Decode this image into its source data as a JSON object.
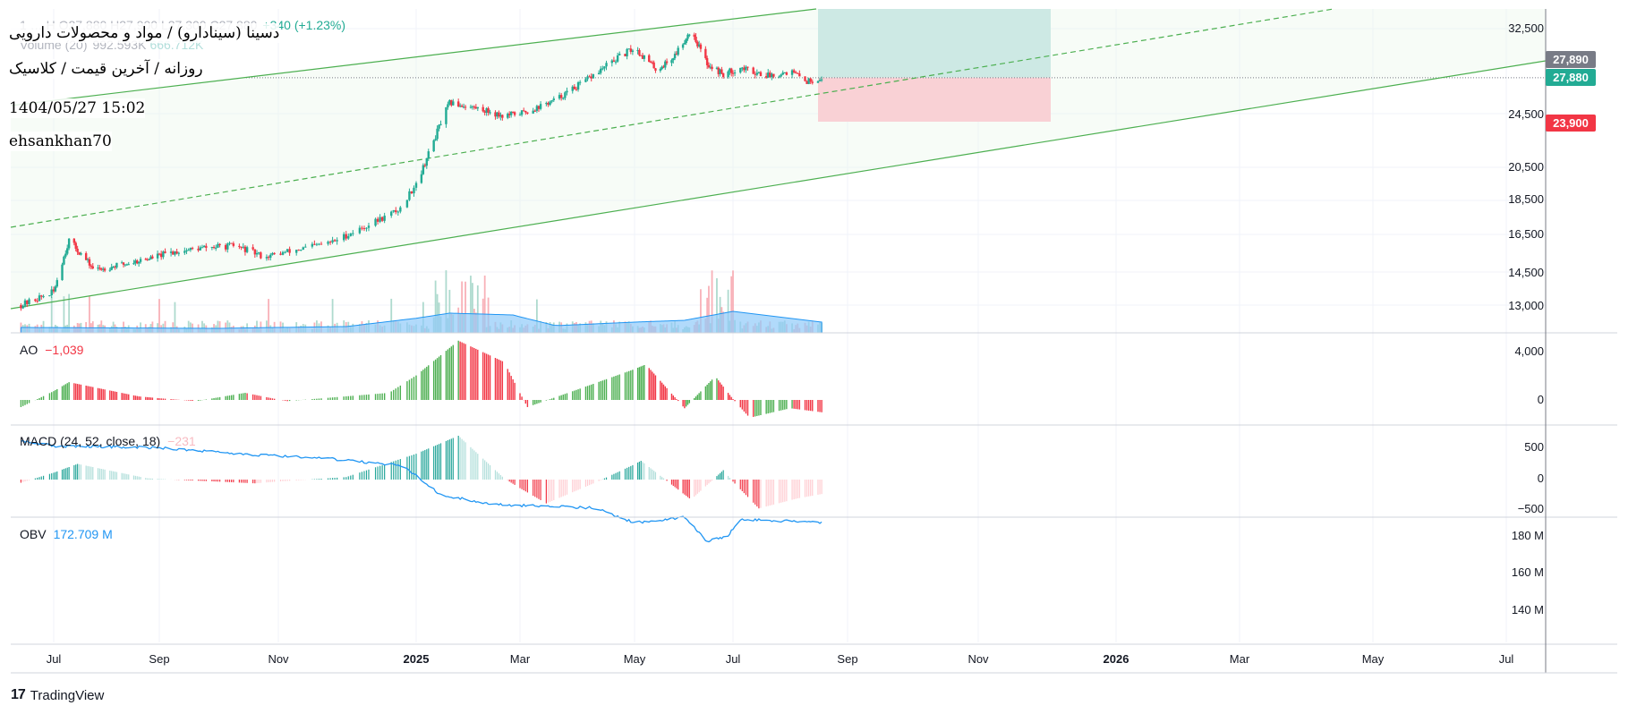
{
  "header": {
    "ohlc_text": "1 … H O27,880 H27,900 L27,300 C27,880",
    "change_text": "+340 (+1.23%)",
    "volume_text": "Volume (20)",
    "volume_value_1": "992.593K",
    "volume_value_2": "666.712K"
  },
  "info": {
    "title": "دسینا (سینادارو) / مواد و محصولات دارویی",
    "subtitle": "روزانه / آخرین قیمت / کلاسیک",
    "datetime": "1404/05/27 15:02",
    "author": "ehsankhan70"
  },
  "price_axis": {
    "ticks": [
      "32,500",
      "24,500",
      "20,500",
      "18,500",
      "16,500",
      "14,500",
      "13,000"
    ],
    "tags": [
      {
        "label": "27,890",
        "color": "#787b86"
      },
      {
        "label": "27,880",
        "color": "#22ab94"
      },
      {
        "label": "23,900",
        "color": "#f23645"
      }
    ]
  },
  "panes": {
    "ao": {
      "name": "AO",
      "value": "−1,039",
      "ticks": [
        "4,000",
        "0"
      ]
    },
    "macd": {
      "name": "MACD (24, 52, close, 18)",
      "value": "−231",
      "ticks": [
        "500",
        "0",
        "−500"
      ]
    },
    "obv": {
      "name": "OBV",
      "value": "172.709 M",
      "ticks": [
        "180 M",
        "160 M",
        "140 M"
      ]
    }
  },
  "time_axis": {
    "labels": [
      {
        "text": "Jul",
        "bold": false
      },
      {
        "text": "Sep",
        "bold": false
      },
      {
        "text": "Nov",
        "bold": false
      },
      {
        "text": "2025",
        "bold": true
      },
      {
        "text": "Mar",
        "bold": false
      },
      {
        "text": "May",
        "bold": false
      },
      {
        "text": "Jul",
        "bold": false
      },
      {
        "text": "Sep",
        "bold": false
      },
      {
        "text": "Nov",
        "bold": false
      },
      {
        "text": "2026",
        "bold": true
      },
      {
        "text": "Mar",
        "bold": false
      },
      {
        "text": "May",
        "bold": false
      },
      {
        "text": "Jul",
        "bold": false
      }
    ]
  },
  "branding": {
    "logo_text": "TradingView"
  },
  "colors": {
    "up": "#22ab94",
    "down": "#f23645",
    "ao_up": "#4caf50",
    "ao_down": "#f23645",
    "channel": "#4caf50",
    "obv": "#2196f3",
    "volume_ma": "#2196f3",
    "target_zone": "#cde9e4",
    "stop_zone": "#f9d1d5"
  },
  "chart_data": {
    "type": "candlestick",
    "symbol": "دسینا",
    "interval": "1D",
    "last": {
      "open": 27880,
      "high": 27900,
      "low": 27300,
      "close": 27880,
      "change": 340,
      "change_pct": 1.23
    },
    "price_axis_ticks": [
      13000,
      14500,
      16500,
      18500,
      20500,
      24500,
      32500
    ],
    "close_series": [
      [
        "2024-06-15",
        13000
      ],
      [
        "2024-07-01",
        13600
      ],
      [
        "2024-07-10",
        16200
      ],
      [
        "2024-07-25",
        14600
      ],
      [
        "2024-08-10",
        14900
      ],
      [
        "2024-08-25",
        15200
      ],
      [
        "2024-09-10",
        15600
      ],
      [
        "2024-09-25",
        15800
      ],
      [
        "2024-10-10",
        15900
      ],
      [
        "2024-10-25",
        15300
      ],
      [
        "2024-11-10",
        15700
      ],
      [
        "2024-11-25",
        16100
      ],
      [
        "2024-12-10",
        17000
      ],
      [
        "2024-12-25",
        18000
      ],
      [
        "2025-01-05",
        20500
      ],
      [
        "2025-01-20",
        25500
      ],
      [
        "2025-02-05",
        25000
      ],
      [
        "2025-02-20",
        24300
      ],
      [
        "2025-03-05",
        24700
      ],
      [
        "2025-03-20",
        25800
      ],
      [
        "2025-04-05",
        27600
      ],
      [
        "2025-04-20",
        29500
      ],
      [
        "2025-05-01",
        30700
      ],
      [
        "2025-05-15",
        28600
      ],
      [
        "2025-05-25",
        29800
      ],
      [
        "2025-06-05",
        32400
      ],
      [
        "2025-06-15",
        29200
      ],
      [
        "2025-06-25",
        28200
      ],
      [
        "2025-07-05",
        28800
      ],
      [
        "2025-07-20",
        28100
      ],
      [
        "2025-08-01",
        28500
      ],
      [
        "2025-08-10",
        27540
      ],
      [
        "2025-08-18",
        27880
      ]
    ],
    "position": {
      "entry": 27890,
      "last": 27880,
      "stop": 23900
    },
    "indicators": {
      "ao": {
        "last": -1039,
        "axis_ticks": [
          0,
          4000
        ]
      },
      "macd": {
        "params": [
          24,
          52,
          "close",
          18
        ],
        "last": -231,
        "axis_ticks": [
          -500,
          0,
          500
        ]
      },
      "obv": {
        "last_m": 172.709,
        "axis_ticks_m": [
          140,
          160,
          180
        ]
      }
    }
  }
}
